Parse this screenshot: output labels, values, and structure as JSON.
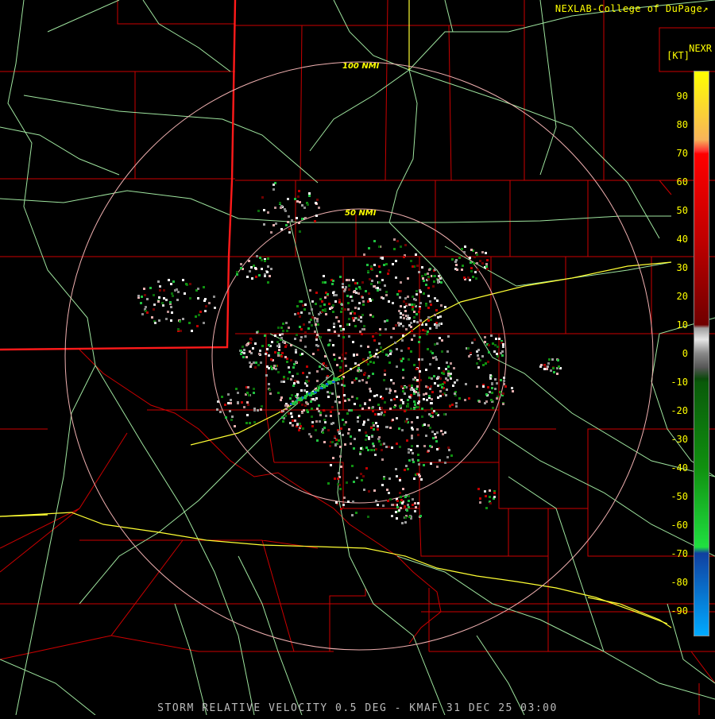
{
  "header": {
    "credit": "NEXLAB-College of DuPage",
    "credit_color": "#ffff00",
    "product": "NEXR",
    "unit": "[KT]"
  },
  "footer": {
    "caption": "STORM RELATIVE VELOCITY 0.5 DEG - KMAF 31 DEC 25 03:00",
    "caption_color": "#bbbbbb"
  },
  "rings": [
    {
      "label": "100 NMI"
    },
    {
      "label": "50 NMI"
    }
  ],
  "colors": {
    "county_lines": "#cc0000",
    "state_line": "#ff1a1a",
    "highways": "#9fe59f",
    "interstates": "#ffff33",
    "rings": "#f0b0b0",
    "ring_labels": "#ffff00"
  },
  "legend": {
    "ticks": [
      "90",
      "80",
      "70",
      "60",
      "50",
      "40",
      "30",
      "20",
      "10",
      "0",
      "-10",
      "-20",
      "-30",
      "-40",
      "-50",
      "-60",
      "-70",
      "-80",
      "-90"
    ],
    "tick_color": "#ffff00",
    "stops": [
      {
        "value": 99,
        "color": "#ffff00"
      },
      {
        "value": 75,
        "color": "#f7b35a"
      },
      {
        "value": 71,
        "color": "#ff3030"
      },
      {
        "value": 70,
        "color": "#ff0000"
      },
      {
        "value": 40,
        "color": "#c00000"
      },
      {
        "value": 10,
        "color": "#700000"
      },
      {
        "value": 9,
        "color": "#a0a0a0"
      },
      {
        "value": 5,
        "color": "#e6e6e6"
      },
      {
        "value": 0,
        "color": "#888888"
      },
      {
        "value": -5,
        "color": "#555555"
      },
      {
        "value": -9,
        "color": "#0a4a0a"
      },
      {
        "value": -10,
        "color": "#0a5a0a"
      },
      {
        "value": -40,
        "color": "#109010"
      },
      {
        "value": -68,
        "color": "#20e040"
      },
      {
        "value": -70,
        "color": "#1040a0"
      },
      {
        "value": -99,
        "color": "#00aaff"
      }
    ]
  }
}
